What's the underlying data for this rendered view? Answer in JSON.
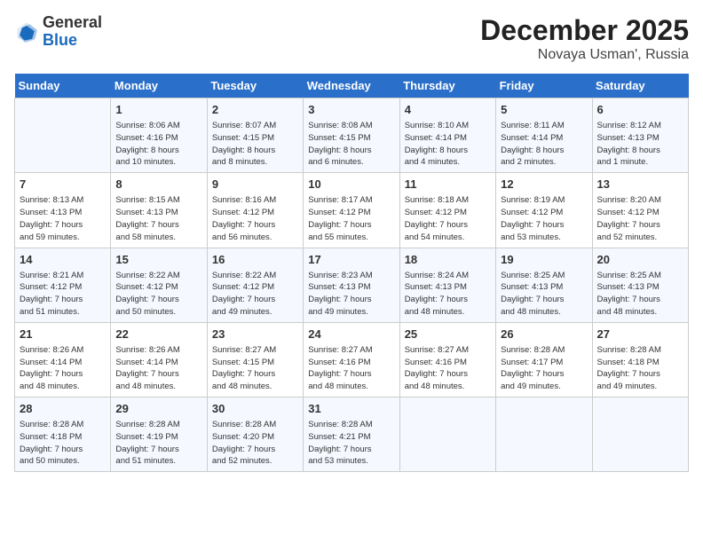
{
  "header": {
    "logo_line1": "General",
    "logo_line2": "Blue",
    "month_year": "December 2025",
    "location": "Novaya Usman', Russia"
  },
  "days_of_week": [
    "Sunday",
    "Monday",
    "Tuesday",
    "Wednesday",
    "Thursday",
    "Friday",
    "Saturday"
  ],
  "weeks": [
    [
      {
        "day": "",
        "info": ""
      },
      {
        "day": "1",
        "info": "Sunrise: 8:06 AM\nSunset: 4:16 PM\nDaylight: 8 hours\nand 10 minutes."
      },
      {
        "day": "2",
        "info": "Sunrise: 8:07 AM\nSunset: 4:15 PM\nDaylight: 8 hours\nand 8 minutes."
      },
      {
        "day": "3",
        "info": "Sunrise: 8:08 AM\nSunset: 4:15 PM\nDaylight: 8 hours\nand 6 minutes."
      },
      {
        "day": "4",
        "info": "Sunrise: 8:10 AM\nSunset: 4:14 PM\nDaylight: 8 hours\nand 4 minutes."
      },
      {
        "day": "5",
        "info": "Sunrise: 8:11 AM\nSunset: 4:14 PM\nDaylight: 8 hours\nand 2 minutes."
      },
      {
        "day": "6",
        "info": "Sunrise: 8:12 AM\nSunset: 4:13 PM\nDaylight: 8 hours\nand 1 minute."
      }
    ],
    [
      {
        "day": "7",
        "info": "Sunrise: 8:13 AM\nSunset: 4:13 PM\nDaylight: 7 hours\nand 59 minutes."
      },
      {
        "day": "8",
        "info": "Sunrise: 8:15 AM\nSunset: 4:13 PM\nDaylight: 7 hours\nand 58 minutes."
      },
      {
        "day": "9",
        "info": "Sunrise: 8:16 AM\nSunset: 4:12 PM\nDaylight: 7 hours\nand 56 minutes."
      },
      {
        "day": "10",
        "info": "Sunrise: 8:17 AM\nSunset: 4:12 PM\nDaylight: 7 hours\nand 55 minutes."
      },
      {
        "day": "11",
        "info": "Sunrise: 8:18 AM\nSunset: 4:12 PM\nDaylight: 7 hours\nand 54 minutes."
      },
      {
        "day": "12",
        "info": "Sunrise: 8:19 AM\nSunset: 4:12 PM\nDaylight: 7 hours\nand 53 minutes."
      },
      {
        "day": "13",
        "info": "Sunrise: 8:20 AM\nSunset: 4:12 PM\nDaylight: 7 hours\nand 52 minutes."
      }
    ],
    [
      {
        "day": "14",
        "info": "Sunrise: 8:21 AM\nSunset: 4:12 PM\nDaylight: 7 hours\nand 51 minutes."
      },
      {
        "day": "15",
        "info": "Sunrise: 8:22 AM\nSunset: 4:12 PM\nDaylight: 7 hours\nand 50 minutes."
      },
      {
        "day": "16",
        "info": "Sunrise: 8:22 AM\nSunset: 4:12 PM\nDaylight: 7 hours\nand 49 minutes."
      },
      {
        "day": "17",
        "info": "Sunrise: 8:23 AM\nSunset: 4:13 PM\nDaylight: 7 hours\nand 49 minutes."
      },
      {
        "day": "18",
        "info": "Sunrise: 8:24 AM\nSunset: 4:13 PM\nDaylight: 7 hours\nand 48 minutes."
      },
      {
        "day": "19",
        "info": "Sunrise: 8:25 AM\nSunset: 4:13 PM\nDaylight: 7 hours\nand 48 minutes."
      },
      {
        "day": "20",
        "info": "Sunrise: 8:25 AM\nSunset: 4:13 PM\nDaylight: 7 hours\nand 48 minutes."
      }
    ],
    [
      {
        "day": "21",
        "info": "Sunrise: 8:26 AM\nSunset: 4:14 PM\nDaylight: 7 hours\nand 48 minutes."
      },
      {
        "day": "22",
        "info": "Sunrise: 8:26 AM\nSunset: 4:14 PM\nDaylight: 7 hours\nand 48 minutes."
      },
      {
        "day": "23",
        "info": "Sunrise: 8:27 AM\nSunset: 4:15 PM\nDaylight: 7 hours\nand 48 minutes."
      },
      {
        "day": "24",
        "info": "Sunrise: 8:27 AM\nSunset: 4:16 PM\nDaylight: 7 hours\nand 48 minutes."
      },
      {
        "day": "25",
        "info": "Sunrise: 8:27 AM\nSunset: 4:16 PM\nDaylight: 7 hours\nand 48 minutes."
      },
      {
        "day": "26",
        "info": "Sunrise: 8:28 AM\nSunset: 4:17 PM\nDaylight: 7 hours\nand 49 minutes."
      },
      {
        "day": "27",
        "info": "Sunrise: 8:28 AM\nSunset: 4:18 PM\nDaylight: 7 hours\nand 49 minutes."
      }
    ],
    [
      {
        "day": "28",
        "info": "Sunrise: 8:28 AM\nSunset: 4:18 PM\nDaylight: 7 hours\nand 50 minutes."
      },
      {
        "day": "29",
        "info": "Sunrise: 8:28 AM\nSunset: 4:19 PM\nDaylight: 7 hours\nand 51 minutes."
      },
      {
        "day": "30",
        "info": "Sunrise: 8:28 AM\nSunset: 4:20 PM\nDaylight: 7 hours\nand 52 minutes."
      },
      {
        "day": "31",
        "info": "Sunrise: 8:28 AM\nSunset: 4:21 PM\nDaylight: 7 hours\nand 53 minutes."
      },
      {
        "day": "",
        "info": ""
      },
      {
        "day": "",
        "info": ""
      },
      {
        "day": "",
        "info": ""
      }
    ]
  ]
}
